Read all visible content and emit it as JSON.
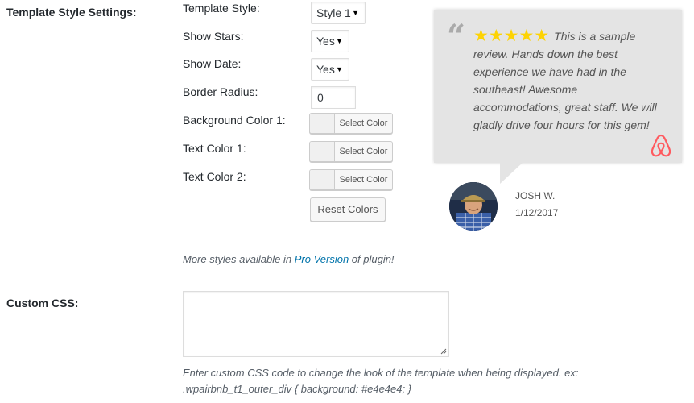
{
  "template_section": {
    "label": "Template Style Settings:",
    "fields": {
      "template_style": {
        "label": "Template Style:",
        "value": "Style 1"
      },
      "show_stars": {
        "label": "Show Stars:",
        "value": "Yes"
      },
      "show_date": {
        "label": "Show Date:",
        "value": "Yes"
      },
      "border_radius": {
        "label": "Border Radius:",
        "value": "0"
      },
      "bg_color_1": {
        "label": "Background Color 1:",
        "button": "Select Color"
      },
      "text_color_1": {
        "label": "Text Color 1:",
        "button": "Select Color"
      },
      "text_color_2": {
        "label": "Text Color 2:",
        "button": "Select Color"
      }
    },
    "reset_button": "Reset Colors",
    "more_styles": {
      "before": "More styles available in ",
      "link": "Pro Version",
      "after": " of plugin!"
    }
  },
  "preview": {
    "quote_mark": "“",
    "stars": "★★★★★",
    "rating": 5,
    "text": "This is a sample review. Hands down the best experience we have had in the southeast! Awesome accommodations, great staff. We will gladly drive four hours for this gem!",
    "reviewer_name": "JOSH W.",
    "date": "1/12/2017",
    "background_color": "#e4e4e4",
    "star_color": "#fdd304",
    "brand_icon": "airbnb-icon",
    "brand_color": "#ff5a5f"
  },
  "custom_css": {
    "label": "Custom CSS:",
    "value": "",
    "help_line_1": "Enter custom CSS code to change the look of the template when being displayed. ex:",
    "help_line_2": ".wpairbnb_t1_outer_div { background: #e4e4e4; }"
  }
}
